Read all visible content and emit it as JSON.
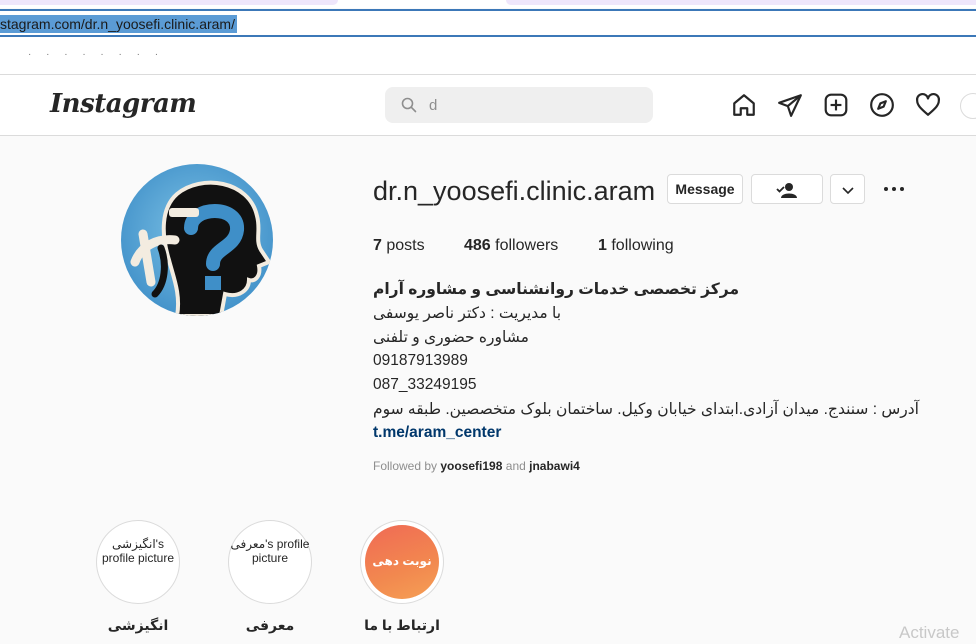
{
  "browser": {
    "url": "stagram.com/dr.n_yoosefi.clinic.aram/"
  },
  "instagram": {
    "logo": "Instagram",
    "search": {
      "value": "d"
    }
  },
  "profile": {
    "username": "dr.n_yoosefi.clinic.aram",
    "buttons": {
      "message": "Message"
    },
    "stats": {
      "posts_count": "7",
      "posts_label": "posts",
      "followers_count": "486",
      "followers_label": "followers",
      "following_count": "1",
      "following_label": "following"
    },
    "bio": {
      "name": "مرکز تخصصی خدمات روانشناسی و مشاوره آرام",
      "lines": [
        "با مدیریت : دکتر ناصر یوسفی",
        "مشاوره حضوری و تلفنی",
        "09187913989",
        "087_33249195",
        "آدرس : سنندج. میدان آزادی.ابتدای خیابان وکیل. ساختمان بلوک متخصصین. طبقه سوم"
      ],
      "link": "t.me/aram_center"
    },
    "followed_by": {
      "prefix": "Followed by",
      "user1": "yoosefi198",
      "and": "and",
      "user2": "jnabawi4"
    }
  },
  "highlights": [
    {
      "label": "انگیزشی",
      "image_alt": "انگیزشی's profile picture"
    },
    {
      "label": "معرفی",
      "image_alt": "معرفی's profile picture"
    },
    {
      "label": "ارتباط با ما",
      "image_text": "نوبت دهی"
    }
  ],
  "watermark": "Activate",
  "colors": {
    "link": "#00376b",
    "highlight_gradient": [
      "#f06a55",
      "#f5a055"
    ],
    "url_selection": "#5b9bd5"
  }
}
